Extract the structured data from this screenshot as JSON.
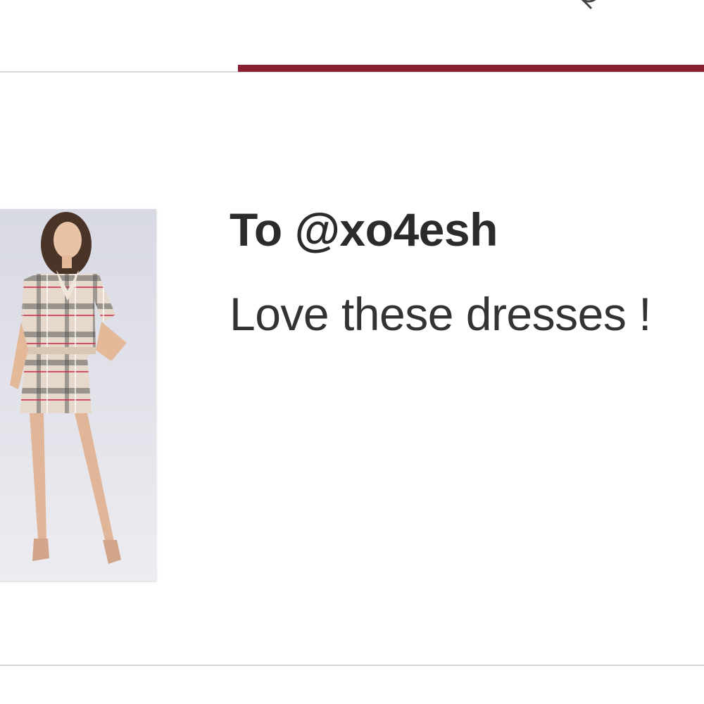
{
  "tabs": {
    "active_color": "#8b1f32",
    "icon": "search-icon"
  },
  "message": {
    "title": "To @xo4esh",
    "body": "Love these dresses !",
    "image_icon": "product-photo-dress"
  }
}
